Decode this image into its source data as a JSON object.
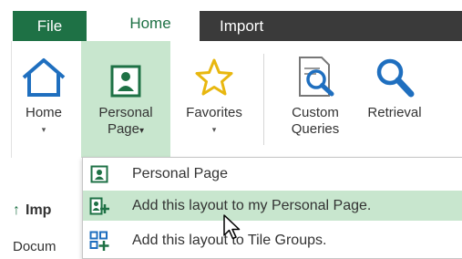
{
  "tabs": {
    "file": "File",
    "home": "Home",
    "import": "Import"
  },
  "ribbon": {
    "home": {
      "label": "Home",
      "caret": "▾"
    },
    "personal": {
      "line1": "Personal",
      "line2": "Page",
      "caret": "▾"
    },
    "favorites": {
      "label": "Favorites",
      "caret": "▾"
    },
    "custom": {
      "line1": "Custom",
      "line2": "Queries"
    },
    "retrieval": {
      "label": "Retrieval"
    }
  },
  "menu": {
    "items": [
      {
        "label": "Personal Page",
        "icon": "personal-page-icon"
      },
      {
        "label": "Add this layout to my Personal Page.",
        "icon": "add-person-icon"
      },
      {
        "label": "Add this layout to Tile Groups.",
        "icon": "add-tile-icon"
      }
    ]
  },
  "panel": {
    "import_label": "Imp",
    "doc_label": "Docum"
  },
  "colors": {
    "green": "#1e7145",
    "highlight": "#c8e6ce",
    "blue": "#1f6fbf",
    "star": "#e8b70f"
  }
}
